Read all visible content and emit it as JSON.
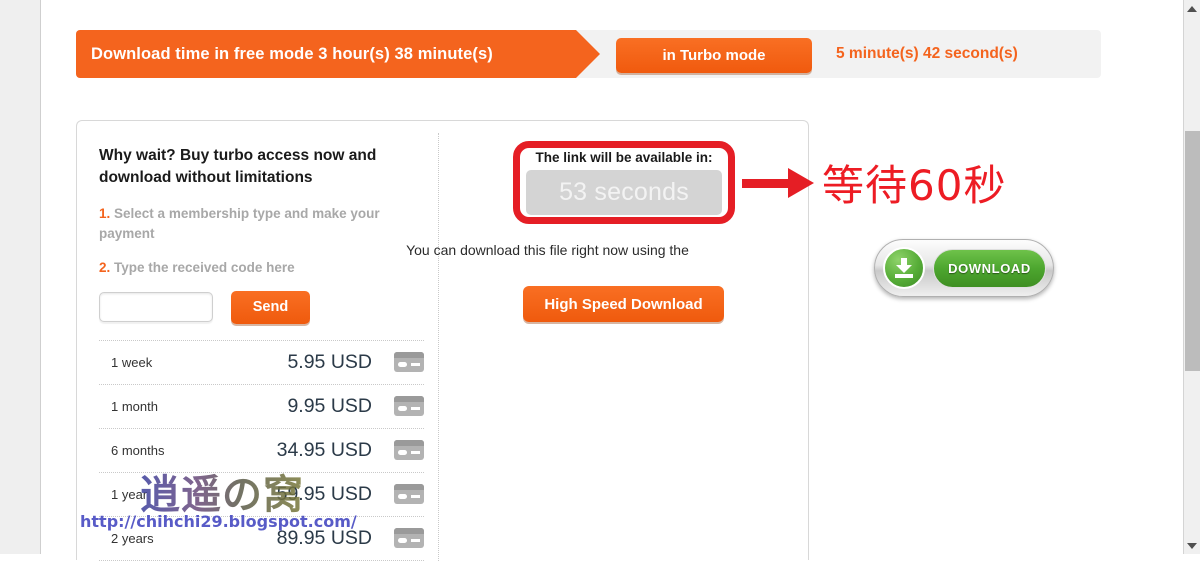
{
  "banner": {
    "free_mode_label": "Download time in free mode 3 hour(s) 38 minute(s)",
    "turbo_button_label": "in Turbo mode",
    "turbo_time_label": "5 minute(s) 42 second(s)",
    "accent_color": "#f4641e"
  },
  "promo": {
    "title": "Why wait? Buy turbo access now and download without limitations",
    "steps": [
      {
        "num": "1.",
        "text": "Select a membership type and make your payment"
      },
      {
        "num": "2.",
        "text": "Type the received code here"
      }
    ],
    "code_input_value": "",
    "code_input_placeholder": "",
    "send_label": "Send"
  },
  "pricing": {
    "rows": [
      {
        "period": "1 week",
        "amount": "5.95 USD"
      },
      {
        "period": "1 month",
        "amount": "9.95 USD"
      },
      {
        "period": "6 months",
        "amount": "34.95 USD"
      },
      {
        "period": "1 year",
        "amount": "59.95 USD"
      },
      {
        "period": "2 years",
        "amount": "89.95 USD"
      }
    ]
  },
  "countdown": {
    "label": "The link will be available in:",
    "value": "53 seconds"
  },
  "center": {
    "note": "You can download this file right now using the",
    "high_speed_label": "High Speed Download"
  },
  "download_widget": {
    "label": "DOWNLOAD"
  },
  "annotation": {
    "text": "等待60秒",
    "color": "#ed1c24"
  },
  "watermark": {
    "logo": "逍遥の窝",
    "url": "http://chihchi29.blogspot.com/"
  }
}
